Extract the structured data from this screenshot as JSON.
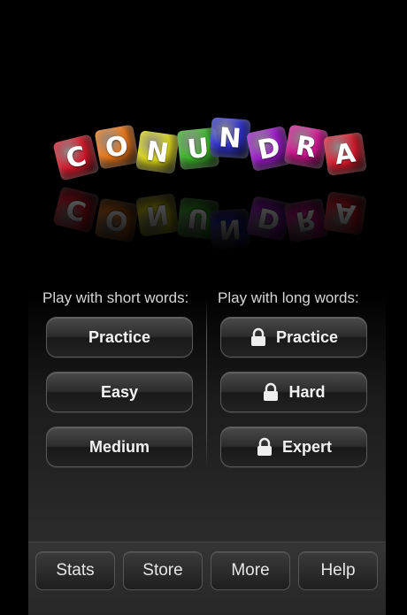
{
  "logo": {
    "letters": [
      {
        "char": "C",
        "color": "#d0182a"
      },
      {
        "char": "O",
        "color": "#e8761a"
      },
      {
        "char": "N",
        "color": "#d8d31c"
      },
      {
        "char": "U",
        "color": "#3cb32a"
      },
      {
        "char": "N",
        "color": "#2d2fc8"
      },
      {
        "char": "D",
        "color": "#9a18c8"
      },
      {
        "char": "R",
        "color": "#d01590"
      },
      {
        "char": "A",
        "color": "#d21a2c"
      }
    ]
  },
  "short_words": {
    "heading": "Play with short words:",
    "buttons": [
      "Practice",
      "Easy",
      "Medium"
    ]
  },
  "long_words": {
    "heading": "Play with long words:",
    "buttons": [
      "Practice",
      "Hard",
      "Expert"
    ],
    "locked": true
  },
  "bottom_bar": {
    "items": [
      "Stats",
      "Store",
      "More",
      "Help"
    ]
  }
}
